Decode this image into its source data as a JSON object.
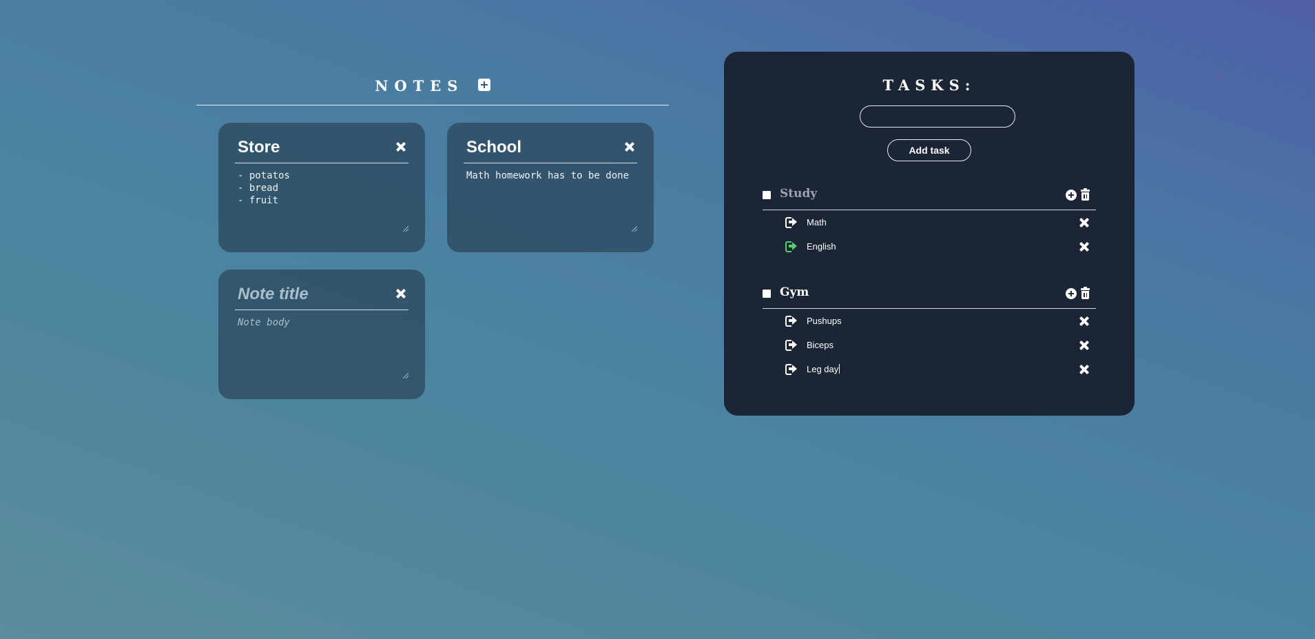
{
  "notes": {
    "heading": "NOTES",
    "items": [
      {
        "title": "Store",
        "body": "- potatos\n- bread\n- fruit"
      },
      {
        "title": "School",
        "body": "Math homework has to be done"
      },
      {
        "title_placeholder": "Note title",
        "body_placeholder": "Note body"
      }
    ]
  },
  "tasks": {
    "heading": "TASKS:",
    "input_value": "",
    "add_button_label": "Add task",
    "groups": [
      {
        "title": "Study",
        "completed_style": true,
        "tasks": [
          {
            "label": "Math",
            "done": false
          },
          {
            "label": "English",
            "done": true
          }
        ]
      },
      {
        "title": "Gym",
        "completed_style": false,
        "tasks": [
          {
            "label": "Pushups",
            "done": false
          },
          {
            "label": "Biceps",
            "done": false
          },
          {
            "label": "Leg day",
            "done": false
          }
        ]
      }
    ]
  },
  "colors": {
    "panel": "#1c2536",
    "note_card": "#2a4458",
    "done_icon": "#4fd26a",
    "accent_dot": "#d0305a"
  },
  "icons": {
    "add_note": "plus-square-icon",
    "close": "close-icon",
    "add_subtask": "plus-circle-icon",
    "delete_group": "trash-icon",
    "task": "sign-out-arrow-icon"
  }
}
